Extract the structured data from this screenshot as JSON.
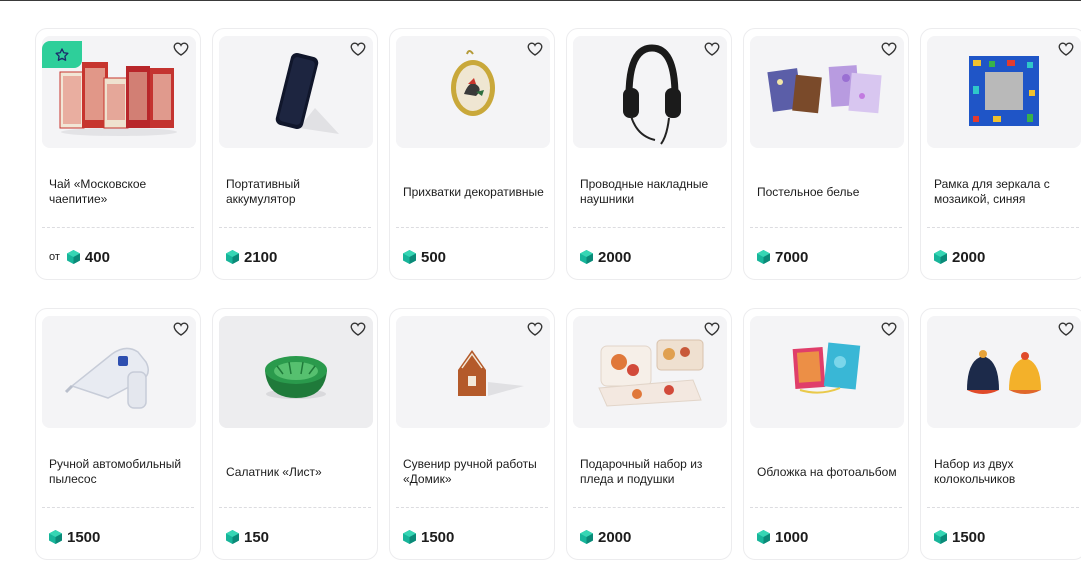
{
  "colors": {
    "accent": "#2ecf9a",
    "gem": "#17b59a",
    "gem_dark": "#0b8a78"
  },
  "products": [
    {
      "title": "Чай «Московское чаепитие»",
      "price_prefix": "от",
      "price": "400",
      "badge": "star-icon",
      "image": "tea-boxes-image"
    },
    {
      "title": "Портативный аккумулятор",
      "price_prefix": "",
      "price": "2100",
      "image": "power-bank-image"
    },
    {
      "title": "Прихватки декоративные",
      "price_prefix": "",
      "price": "500",
      "image": "potholder-image"
    },
    {
      "title": "Проводные накладные наушники",
      "price_prefix": "",
      "price": "2000",
      "image": "headphones-image"
    },
    {
      "title": "Постельное белье",
      "price_prefix": "",
      "price": "7000",
      "image": "bed-linen-image"
    },
    {
      "title": "Рамка для зеркала с мозаикой, синяя",
      "price_prefix": "",
      "price": "2000",
      "image": "mosaic-frame-image"
    },
    {
      "title": "Ручной автомобильный пылесос",
      "price_prefix": "",
      "price": "1500",
      "image": "car-vacuum-image"
    },
    {
      "title": "Салатник «Лист»",
      "price_prefix": "",
      "price": "150",
      "image": "salad-bowl-image"
    },
    {
      "title": "Сувенир ручной работы «Домик»",
      "price_prefix": "",
      "price": "1500",
      "image": "house-souvenir-image"
    },
    {
      "title": "Подарочный набор из пледа и подушки",
      "price_prefix": "",
      "price": "2000",
      "image": "blanket-pillow-image"
    },
    {
      "title": "Обложка на фотоальбом",
      "price_prefix": "",
      "price": "1000",
      "image": "album-cover-image"
    },
    {
      "title": "Набор из двух колокольчиков",
      "price_prefix": "",
      "price": "1500",
      "image": "bells-image"
    }
  ]
}
